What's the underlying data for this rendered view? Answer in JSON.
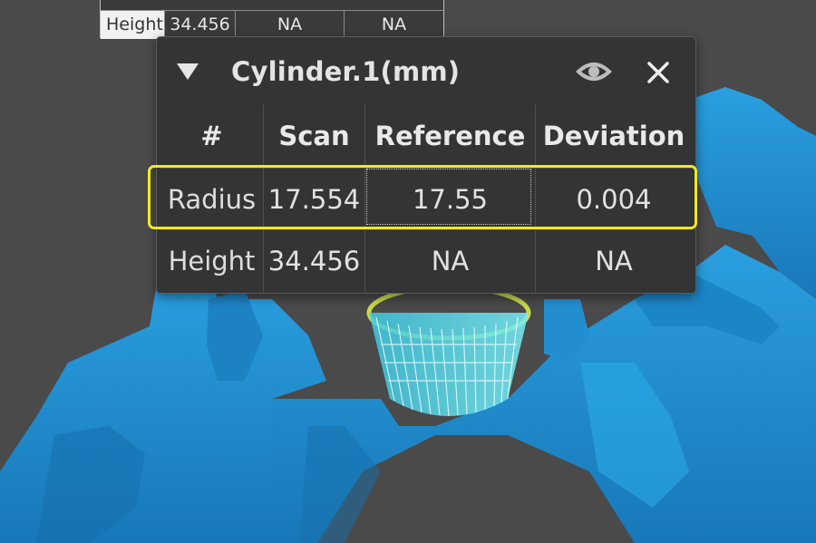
{
  "background_table": {
    "row_label": "Height",
    "cells": [
      "34.456",
      "NA",
      "NA"
    ]
  },
  "panel": {
    "title": "Cylinder.1(mm)",
    "icons": {
      "collapse": "triangle-down-icon",
      "visibility": "eye-icon",
      "close": "close-icon"
    },
    "columns": [
      "#",
      "Scan",
      "Reference",
      "Deviation"
    ],
    "rows": [
      {
        "label": "Radius",
        "scan": "17.554",
        "reference": "17.55",
        "deviation": "0.004",
        "highlighted": true
      },
      {
        "label": "Height",
        "scan": "34.456",
        "reference": "NA",
        "deviation": "NA",
        "highlighted": false
      }
    ]
  },
  "colors": {
    "highlight": "#f0ea1e",
    "scan_mesh": "#1f8fd0",
    "wireframe": "#5fe3ec",
    "panel_bg": "#343434",
    "viewport_bg": "#4a4a4a"
  }
}
